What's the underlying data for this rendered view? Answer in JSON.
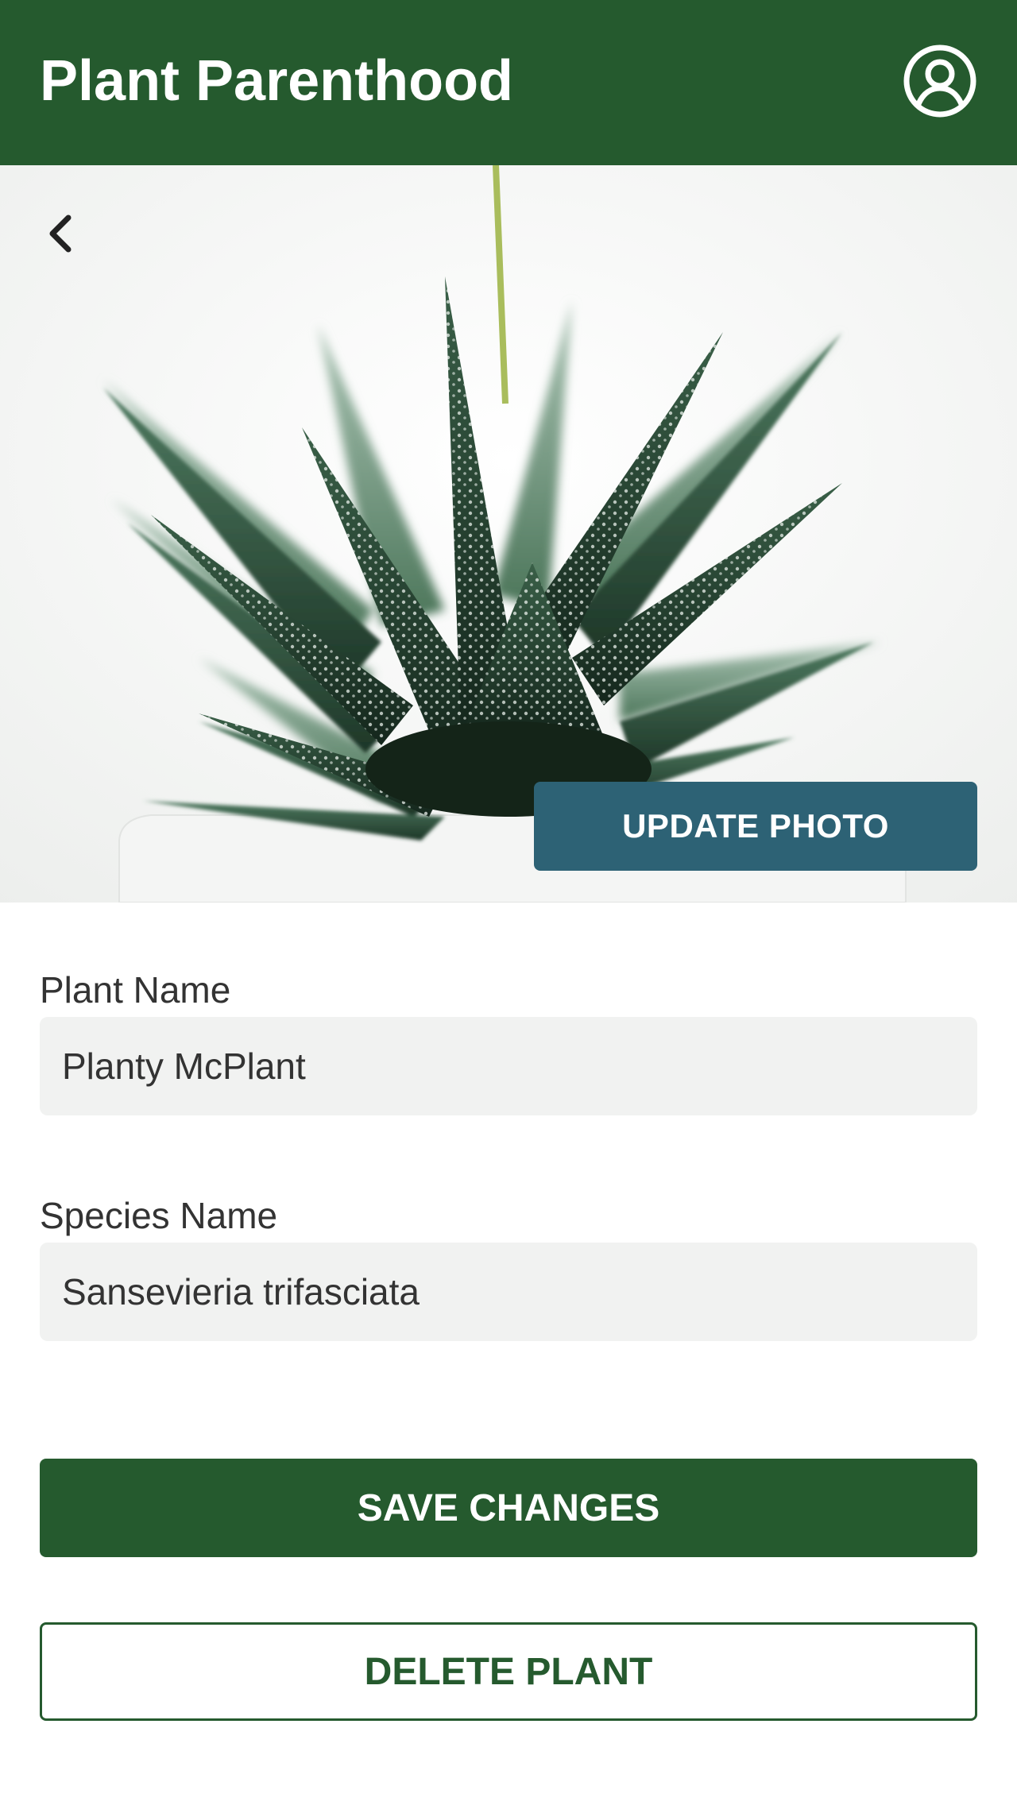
{
  "header": {
    "title": "Plant Parenthood",
    "profile_icon": "user-circle-icon"
  },
  "hero": {
    "back_icon": "chevron-left-icon",
    "update_photo_label": "UPDATE PHOTO",
    "photo_subject": "succulent"
  },
  "form": {
    "plant_name": {
      "label": "Plant Name",
      "value": "Planty McPlant"
    },
    "species_name": {
      "label": "Species Name",
      "value": "Sansevieria trifasciata"
    }
  },
  "actions": {
    "save_label": "SAVE CHANGES",
    "delete_label": "DELETE PLANT"
  },
  "colors": {
    "brand_green": "#255a2e",
    "photo_button_blue": "#2d6275",
    "field_background": "#f1f2f1"
  }
}
